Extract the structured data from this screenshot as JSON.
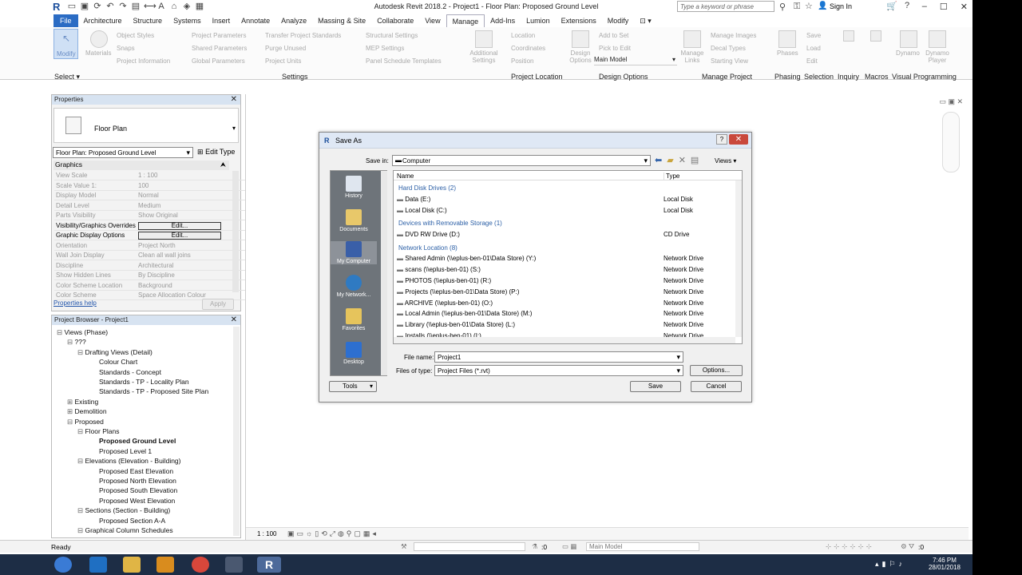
{
  "titlebar": {
    "title": "Autodesk Revit 2018.2 -   Project1 - Floor Plan: Proposed Ground Level",
    "search_placeholder": "Type a keyword or phrase",
    "signin": "Sign In"
  },
  "menu": [
    "File",
    "Architecture",
    "Structure",
    "Systems",
    "Insert",
    "Annotate",
    "Analyze",
    "Massing & Site",
    "Collaborate",
    "View",
    "Manage",
    "Add-Ins",
    "Lumion",
    "Extensions",
    "Modify"
  ],
  "ribbon": {
    "modify": "Modify",
    "materials": "Materials",
    "object_styles": "Object  Styles",
    "snaps": "Snaps",
    "project_information": "Project  Information",
    "project_parameters": "Project  Parameters",
    "shared_parameters": "Shared  Parameters",
    "global_parameters": "Global  Parameters",
    "transfer_standards": "Transfer  Project Standards",
    "purge_unused": "Purge  Unused",
    "project_units": "Project  Units",
    "structural_settings": "Structural  Settings",
    "mep_settings": "MEP  Settings",
    "panel_schedule": "Panel  Schedule  Templates",
    "additional_settings": "Additional Settings",
    "location": "Location",
    "coordinates": "Coordinates",
    "position": "Position",
    "design_options": "Design Options",
    "add_to_set": "Add  to  Set",
    "pick_to_edit": "Pick  to  Edit",
    "main_model": "Main  Model",
    "manage_links": "Manage Links",
    "manage_images": "Manage  Images",
    "decal_types": "Decal  Types",
    "starting_view": "Starting  View",
    "phases": "Phases",
    "save": "Save",
    "load": "Load",
    "edit": "Edit",
    "dynamo": "Dynamo",
    "dynamo_player": "Dynamo Player",
    "groups": [
      "Select",
      "Settings",
      "Project Location",
      "Design Options",
      "Manage Project",
      "Phasing",
      "Selection",
      "Inquiry",
      "Macros",
      "Visual Programming"
    ]
  },
  "properties": {
    "header": "Properties",
    "type": "Floor Plan",
    "instance": "Floor Plan: Proposed Ground Level",
    "edit_type": "Edit Type",
    "section": "Graphics",
    "rows": [
      {
        "k": "View Scale",
        "v": "1 : 100"
      },
      {
        "k": "Scale Value    1:",
        "v": "100"
      },
      {
        "k": "Display Model",
        "v": "Normal"
      },
      {
        "k": "Detail Level",
        "v": "Medium"
      },
      {
        "k": "Parts Visibility",
        "v": "Show Original"
      },
      {
        "k": "Visibility/Graphics Overrides",
        "v": "Edit..."
      },
      {
        "k": "Graphic Display Options",
        "v": "Edit..."
      },
      {
        "k": "Orientation",
        "v": "Project North"
      },
      {
        "k": "Wall Join Display",
        "v": "Clean all wall joins"
      },
      {
        "k": "Discipline",
        "v": "Architectural"
      },
      {
        "k": "Show Hidden Lines",
        "v": "By Discipline"
      },
      {
        "k": "Color Scheme Location",
        "v": "Background"
      },
      {
        "k": "Color Scheme",
        "v": "Space Allocation Colour"
      }
    ],
    "help": "Properties help",
    "apply": "Apply"
  },
  "browser": {
    "header": "Project Browser - Project1",
    "items": [
      {
        "t": "Views (Phase)",
        "l": 0,
        "s": "−"
      },
      {
        "t": "???",
        "l": 1,
        "s": "−"
      },
      {
        "t": "Drafting Views (Detail)",
        "l": 2,
        "s": "−"
      },
      {
        "t": "Colour Chart",
        "l": 3,
        "s": ""
      },
      {
        "t": "Standards - Concept",
        "l": 3,
        "s": ""
      },
      {
        "t": "Standards - TP - Locality Plan",
        "l": 3,
        "s": ""
      },
      {
        "t": "Standards - TP - Proposed Site Plan",
        "l": 3,
        "s": ""
      },
      {
        "t": "Existing",
        "l": 1,
        "s": "+"
      },
      {
        "t": "Demolition",
        "l": 1,
        "s": "+"
      },
      {
        "t": "Proposed",
        "l": 1,
        "s": "−"
      },
      {
        "t": "Floor Plans",
        "l": 2,
        "s": "−"
      },
      {
        "t": "Proposed Ground Level",
        "l": 3,
        "s": "",
        "b": true
      },
      {
        "t": "Proposed Level 1",
        "l": 3,
        "s": ""
      },
      {
        "t": "Elevations (Elevation - Building)",
        "l": 2,
        "s": "−"
      },
      {
        "t": "Proposed East Elevation",
        "l": 3,
        "s": ""
      },
      {
        "t": "Proposed North Elevation",
        "l": 3,
        "s": ""
      },
      {
        "t": "Proposed South Elevation",
        "l": 3,
        "s": ""
      },
      {
        "t": "Proposed West Elevation",
        "l": 3,
        "s": ""
      },
      {
        "t": "Sections (Section - Building)",
        "l": 2,
        "s": "−"
      },
      {
        "t": "Proposed Section A-A",
        "l": 3,
        "s": ""
      },
      {
        "t": "Graphical Column Schedules",
        "l": 2,
        "s": "−"
      }
    ]
  },
  "dialog": {
    "title": "Save As",
    "save_in_label": "Save in:",
    "save_in": "Computer",
    "views": "Views",
    "col_name": "Name",
    "col_type": "Type",
    "places": [
      "History",
      "Documents",
      "My Computer",
      "My Network...",
      "Favorites",
      "Desktop"
    ],
    "groups": {
      "hdd": "Hard Disk Drives (2)",
      "removable": "Devices with Removable Storage (1)",
      "network": "Network Location (8)"
    },
    "rows": [
      {
        "n": "Data (E:)",
        "t": "Local Disk"
      },
      {
        "n": "Local Disk (C:)",
        "t": "Local Disk"
      },
      {
        "n": "DVD RW Drive (D:)",
        "t": "CD Drive"
      },
      {
        "n": "Shared Admin (\\\\eplus-ben-01\\Data Store) (Y:)",
        "t": "Network Drive"
      },
      {
        "n": "scans (\\\\eplus-ben-01) (S:)",
        "t": "Network Drive"
      },
      {
        "n": "PHOTOS (\\\\eplus-ben-01) (R:)",
        "t": "Network Drive"
      },
      {
        "n": "Projects (\\\\eplus-ben-01\\Data Store) (P:)",
        "t": "Network Drive"
      },
      {
        "n": "ARCHIVE (\\\\eplus-ben-01) (O:)",
        "t": "Network Drive"
      },
      {
        "n": "Local Admin (\\\\eplus-ben-01\\Data Store) (M:)",
        "t": "Network Drive"
      },
      {
        "n": "Library (\\\\eplus-ben-01\\Data Store) (L:)",
        "t": "Network Drive"
      },
      {
        "n": "Installs (\\\\eplus-ben-01) (I:)",
        "t": "Network Drive"
      }
    ],
    "file_name_label": "File name:",
    "file_name": "Project1",
    "file_type_label": "Files of type:",
    "file_type": "Project Files  (*.rvt)",
    "options": "Options...",
    "tools": "Tools",
    "save": "Save",
    "cancel": "Cancel"
  },
  "view": {
    "scale": "1 : 100"
  },
  "status": {
    "ready": "Ready",
    "zero": ":0",
    "model": "Main Model",
    "filter": ":0"
  },
  "tray": {
    "time": "7:46 PM",
    "date": "28/01/2018"
  }
}
